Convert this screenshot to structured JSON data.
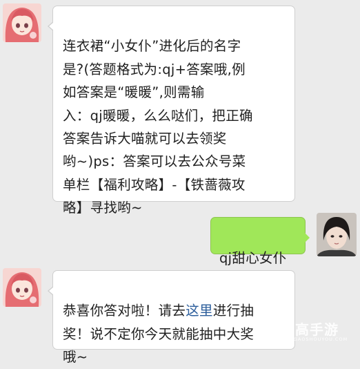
{
  "messages": [
    {
      "side": "left",
      "text": "连衣裙“小女仆”进化后的名字\n是?(答题格式为:qj+答案哦,例\n如答案是“暖暖”,则需输\n入：qj暖暖，么么哒们，把正确\n答案告诉大喵就可以去领奖\n哟~)ps：答案可以去公众号菜\n单栏【福利攻略】-【铁蔷薇攻\n略】寻找哟~"
    },
    {
      "side": "right",
      "text": "qj甜心女仆"
    },
    {
      "side": "left",
      "text_before_link": "恭喜你答对啦！请去",
      "link_text": "这里",
      "text_after_link": "进行抽\n奖！说不定你今天就能抽中大奖\n哦~"
    }
  ],
  "watermark": {
    "brand": "高手游",
    "url": "GAOSHOUYOU.COM"
  },
  "colors": {
    "background": "#ebebeb",
    "incoming_bubble": "#ffffff",
    "outgoing_bubble": "#a0e759",
    "link": "#2b5d9b"
  },
  "icons": {
    "bot_avatar": "anime-girl-avatar",
    "user_avatar": "user-photo-avatar",
    "watermark_logo": "gaoshouyou-logo-icon"
  }
}
